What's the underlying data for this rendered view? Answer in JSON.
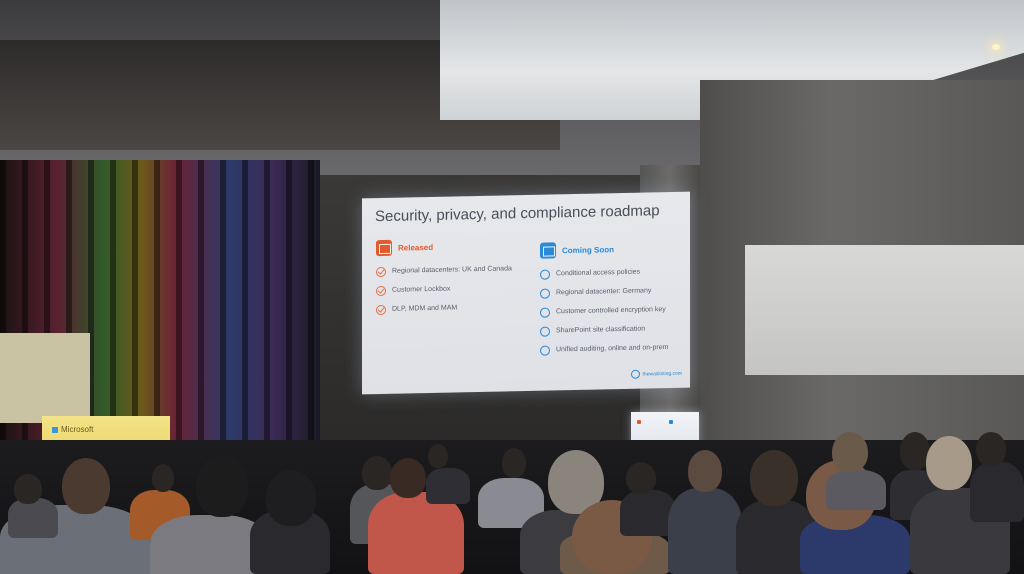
{
  "slide": {
    "title": "Security, privacy, and compliance roadmap",
    "released": {
      "label": "Released",
      "items": [
        "Regional datacenters: UK and Canada",
        "Customer Lockbox",
        "DLP, MDM and MAM"
      ]
    },
    "coming_soon": {
      "label": "Coming Soon",
      "items": [
        "Conditional access policies",
        "Regional datacenter: Germany",
        "Customer controlled encryption key",
        "SharePoint site classification",
        "Unified auditing, online and on-prem"
      ]
    },
    "footer": "thewaitlisting.com"
  },
  "stage": {
    "logo_text": "Microsoft"
  },
  "colors": {
    "released": "#e25b2f",
    "coming_soon": "#2b8ad6",
    "slide_bg": "#e6e8ec"
  },
  "icons": {
    "released": "calendar-icon",
    "coming_soon": "calendar-icon",
    "released_item": "check-circle-icon",
    "coming_item": "empty-circle-icon"
  }
}
